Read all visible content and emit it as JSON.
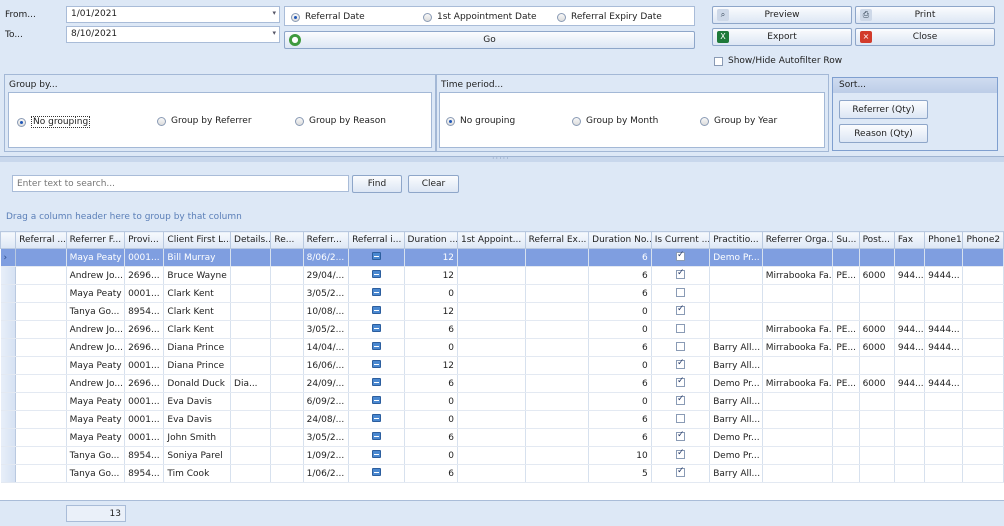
{
  "filters": {
    "from_label": "From...",
    "from_value": "1/01/2021",
    "to_label": "To...",
    "to_value": "8/10/2021",
    "date_types": [
      {
        "label": "Referral Date",
        "selected": true
      },
      {
        "label": "1st Appointment Date",
        "selected": false
      },
      {
        "label": "Referral Expiry Date",
        "selected": false
      }
    ],
    "go_label": "Go"
  },
  "actions": {
    "preview": "Preview",
    "print": "Print",
    "export": "Export",
    "close": "Close",
    "autofilter_label": "Show/Hide Autofilter Row"
  },
  "group_by": {
    "title": "Group by...",
    "options": [
      {
        "label": "No grouping",
        "selected": true
      },
      {
        "label": "Group by Referrer",
        "selected": false
      },
      {
        "label": "Group by Reason",
        "selected": false
      }
    ]
  },
  "time_period": {
    "title": "Time period...",
    "options": [
      {
        "label": "No grouping",
        "selected": true
      },
      {
        "label": "Group by Month",
        "selected": false
      },
      {
        "label": "Group by Year",
        "selected": false
      }
    ]
  },
  "sort": {
    "title": "Sort...",
    "referrer": "Referrer (Qty)",
    "reason": "Reason (Qty)"
  },
  "search": {
    "placeholder": "Enter text to search...",
    "find": "Find",
    "clear": "Clear"
  },
  "group_panel_hint": "Drag a column header here to group by that column",
  "grid": {
    "columns": [
      "Referral ...",
      "Referrer F...",
      "Provi...",
      "Client First L...",
      "Details...",
      "Re...",
      "Referr...",
      "Referral i...",
      "Duration ...",
      "1st Appoint...",
      "Referral Ex...",
      "Duration No...",
      "Is Current ...",
      "Practitio...",
      "Referrer Orga...",
      "Su...",
      "Post...",
      "Fax",
      "Phone1",
      "Phone2"
    ],
    "rows": [
      {
        "selected": true,
        "referrer": "Maya Peaty",
        "provider": "0001...",
        "client": "Bill Murray",
        "details": "",
        "referral_date": "8/06/2...",
        "duration": "12",
        "duration_no": "6",
        "is_current": true,
        "practitioner": "Demo Pr...",
        "org": "",
        "suburb": "",
        "post": "",
        "fax": "",
        "phone1": ""
      },
      {
        "selected": false,
        "referrer": "Andrew Jo...",
        "provider": "2696...",
        "client": "Bruce Wayne",
        "details": "",
        "referral_date": "29/04/...",
        "duration": "12",
        "duration_no": "6",
        "is_current": true,
        "practitioner": "",
        "org": "Mirrabooka Fa...",
        "suburb": "PE...",
        "post": "6000",
        "fax": "944...",
        "phone1": "9444..."
      },
      {
        "selected": false,
        "referrer": "Maya Peaty",
        "provider": "0001...",
        "client": "Clark Kent",
        "details": "",
        "referral_date": "3/05/2...",
        "duration": "0",
        "duration_no": "6",
        "is_current": false,
        "practitioner": "",
        "org": "",
        "suburb": "",
        "post": "",
        "fax": "",
        "phone1": ""
      },
      {
        "selected": false,
        "referrer": "Tanya Go...",
        "provider": "8954...",
        "client": "Clark Kent",
        "details": "",
        "referral_date": "10/08/...",
        "duration": "12",
        "duration_no": "0",
        "is_current": true,
        "practitioner": "",
        "org": "",
        "suburb": "",
        "post": "",
        "fax": "",
        "phone1": ""
      },
      {
        "selected": false,
        "referrer": "Andrew Jo...",
        "provider": "2696...",
        "client": "Clark Kent",
        "details": "",
        "referral_date": "3/05/2...",
        "duration": "6",
        "duration_no": "0",
        "is_current": false,
        "practitioner": "",
        "org": "Mirrabooka Fa...",
        "suburb": "PE...",
        "post": "6000",
        "fax": "944...",
        "phone1": "9444..."
      },
      {
        "selected": false,
        "referrer": "Andrew Jo...",
        "provider": "2696...",
        "client": "Diana Prince",
        "details": "",
        "referral_date": "14/04/...",
        "duration": "0",
        "duration_no": "6",
        "is_current": false,
        "practitioner": "Barry All...",
        "org": "Mirrabooka Fa...",
        "suburb": "PE...",
        "post": "6000",
        "fax": "944...",
        "phone1": "9444..."
      },
      {
        "selected": false,
        "referrer": "Maya Peaty",
        "provider": "0001...",
        "client": "Diana Prince",
        "details": "",
        "referral_date": "16/06/...",
        "duration": "12",
        "duration_no": "0",
        "is_current": true,
        "practitioner": "Barry All...",
        "org": "",
        "suburb": "",
        "post": "",
        "fax": "",
        "phone1": ""
      },
      {
        "selected": false,
        "referrer": "Andrew Jo...",
        "provider": "2696...",
        "client": "Donald Duck",
        "details": "Dia...",
        "referral_date": "24/09/...",
        "duration": "6",
        "duration_no": "6",
        "is_current": true,
        "practitioner": "Demo Pr...",
        "org": "Mirrabooka Fa...",
        "suburb": "PE...",
        "post": "6000",
        "fax": "944...",
        "phone1": "9444..."
      },
      {
        "selected": false,
        "referrer": "Maya Peaty",
        "provider": "0001...",
        "client": "Eva Davis",
        "details": "",
        "referral_date": "6/09/2...",
        "duration": "0",
        "duration_no": "0",
        "is_current": true,
        "practitioner": "Barry All...",
        "org": "",
        "suburb": "",
        "post": "",
        "fax": "",
        "phone1": ""
      },
      {
        "selected": false,
        "referrer": "Maya Peaty",
        "provider": "0001...",
        "client": "Eva Davis",
        "details": "",
        "referral_date": "24/08/...",
        "duration": "0",
        "duration_no": "6",
        "is_current": false,
        "practitioner": "Barry All...",
        "org": "",
        "suburb": "",
        "post": "",
        "fax": "",
        "phone1": ""
      },
      {
        "selected": false,
        "referrer": "Maya Peaty",
        "provider": "0001...",
        "client": "John Smith",
        "details": "",
        "referral_date": "3/05/2...",
        "duration": "6",
        "duration_no": "6",
        "is_current": true,
        "practitioner": "Demo Pr...",
        "org": "",
        "suburb": "",
        "post": "",
        "fax": "",
        "phone1": ""
      },
      {
        "selected": false,
        "referrer": "Tanya Go...",
        "provider": "8954...",
        "client": "Soniya Parel",
        "details": "",
        "referral_date": "1/09/2...",
        "duration": "0",
        "duration_no": "10",
        "is_current": true,
        "practitioner": "Demo Pr...",
        "org": "",
        "suburb": "",
        "post": "",
        "fax": "",
        "phone1": ""
      },
      {
        "selected": false,
        "referrer": "Tanya Go...",
        "provider": "8954...",
        "client": "Tim Cook",
        "details": "",
        "referral_date": "1/06/2...",
        "duration": "6",
        "duration_no": "5",
        "is_current": true,
        "practitioner": "Barry All...",
        "org": "",
        "suburb": "",
        "post": "",
        "fax": "",
        "phone1": ""
      }
    ],
    "footer_count": "13"
  }
}
